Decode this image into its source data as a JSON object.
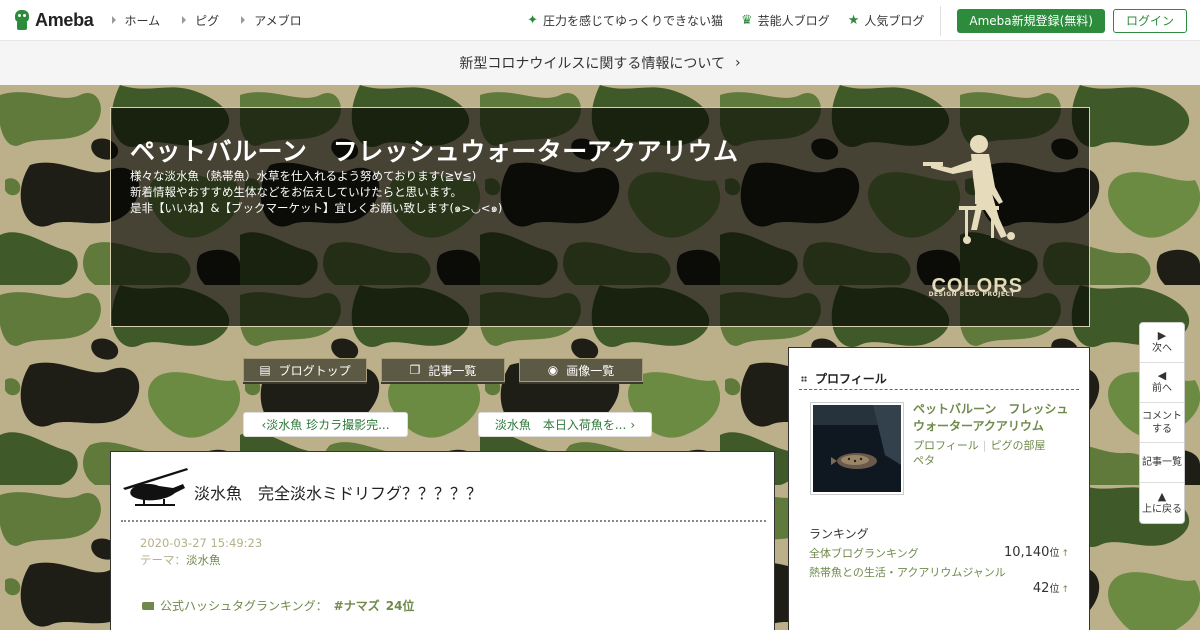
{
  "header": {
    "logo_text": "Ameba",
    "nav": [
      {
        "label": "ホーム"
      },
      {
        "label": "ピグ"
      },
      {
        "label": "アメブロ"
      }
    ],
    "right_links": [
      {
        "label": "圧力を感じてゆっくりできない猫",
        "icon": "sparkle-icon"
      },
      {
        "label": "芸能人ブログ",
        "icon": "crown-icon"
      },
      {
        "label": "人気ブログ",
        "icon": "star-icon"
      }
    ],
    "register_label": "Ameba新規登録(無料)",
    "login_label": "ログイン"
  },
  "notice": {
    "text": "新型コロナウイルスに関する情報について"
  },
  "banner": {
    "title": "ペットバルーン　フレッシュウォーターアクアリウム",
    "desc": [
      "様々な淡水魚（熱帯魚）水草を仕入れるよう努めております(≧∀≦)",
      "新着情報やおすすめ生体などをお伝えしていけたらと思います。",
      "是非【いいね】&【ブックマーケット】宜しくお願い致します(๑>◡<๑)"
    ],
    "brand": "COLORS",
    "brand_sub": "DESIGN BLOG PROJECT"
  },
  "tabs": [
    {
      "label": "ブログトップ",
      "icon": "list-icon"
    },
    {
      "label": "記事一覧",
      "icon": "pages-icon"
    },
    {
      "label": "画像一覧",
      "icon": "camera-icon"
    }
  ],
  "pager": {
    "prev": "淡水魚 珍カラ撮影完...",
    "next": "淡水魚　本日入荷魚を..."
  },
  "article": {
    "title": "淡水魚　完全淡水ミドリフグ？？？？？",
    "date": "2020-03-27 15:49:23",
    "theme_label": "テーマ：",
    "theme": "淡水魚",
    "hashtag_label": "公式ハッシュタグランキング：",
    "hashtag": "#ナマズ",
    "hashtag_rank": "24位"
  },
  "profile": {
    "heading": "プロフィール",
    "name": "ペットバルーン　フレッシュウォーターアクアリウム",
    "link_profile": "プロフィール",
    "link_room": "ピグの部屋",
    "link_peta": "ペタ",
    "ranking_heading": "ランキング",
    "rank1_label": "全体ブログランキング",
    "rank1_value": "10,140",
    "rank2_label": "熱帯魚との生活・アクアリウムジャンル",
    "rank2_value": "42",
    "rank_unit": "位",
    "rank_arrow": "↑"
  },
  "sidetools": [
    {
      "label": "次へ",
      "icon": "▶"
    },
    {
      "label": "前へ",
      "icon": "◀"
    },
    {
      "label": "コメント\nする",
      "icon": ""
    },
    {
      "label": "記事一覧",
      "icon": ""
    },
    {
      "label": "上に戻る",
      "icon": "▲"
    }
  ]
}
